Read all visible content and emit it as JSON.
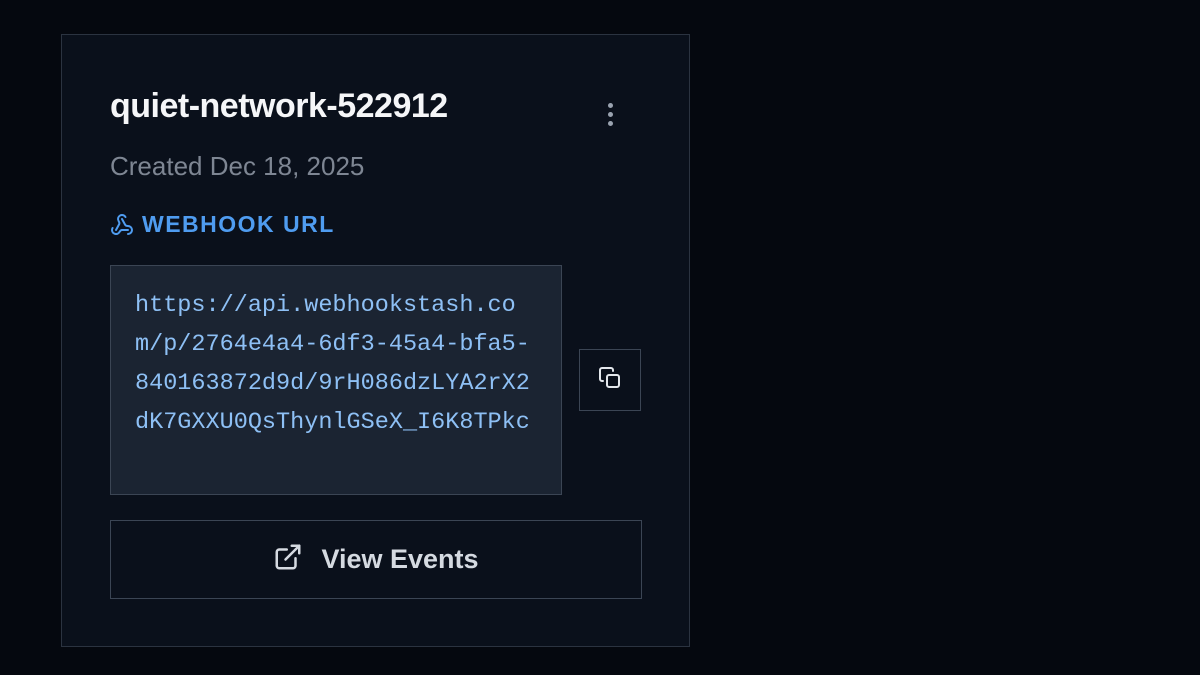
{
  "card": {
    "title": "quiet-network-522912",
    "created": "Created Dec 18, 2025",
    "webhook_label": "WEBHOOK URL",
    "webhook_url": "https://api.webhookstash.com/p/2764e4a4-6df3-45a4-bfa5-840163872d9d/9rH086dzLYA2rX2dK7GXXU0QsThynlGSeX_I6K8TPkc",
    "view_events_label": "View Events"
  },
  "icons": {
    "menu": "more-vertical-icon",
    "webhook": "webhook-icon",
    "copy": "copy-icon",
    "external": "external-link-icon"
  },
  "colors": {
    "background": "#05080f",
    "card": "#0a101b",
    "accent": "#4f9cf0",
    "url_text": "#8ec0f5",
    "url_box": "#1b2432",
    "border": "#3b4554"
  }
}
